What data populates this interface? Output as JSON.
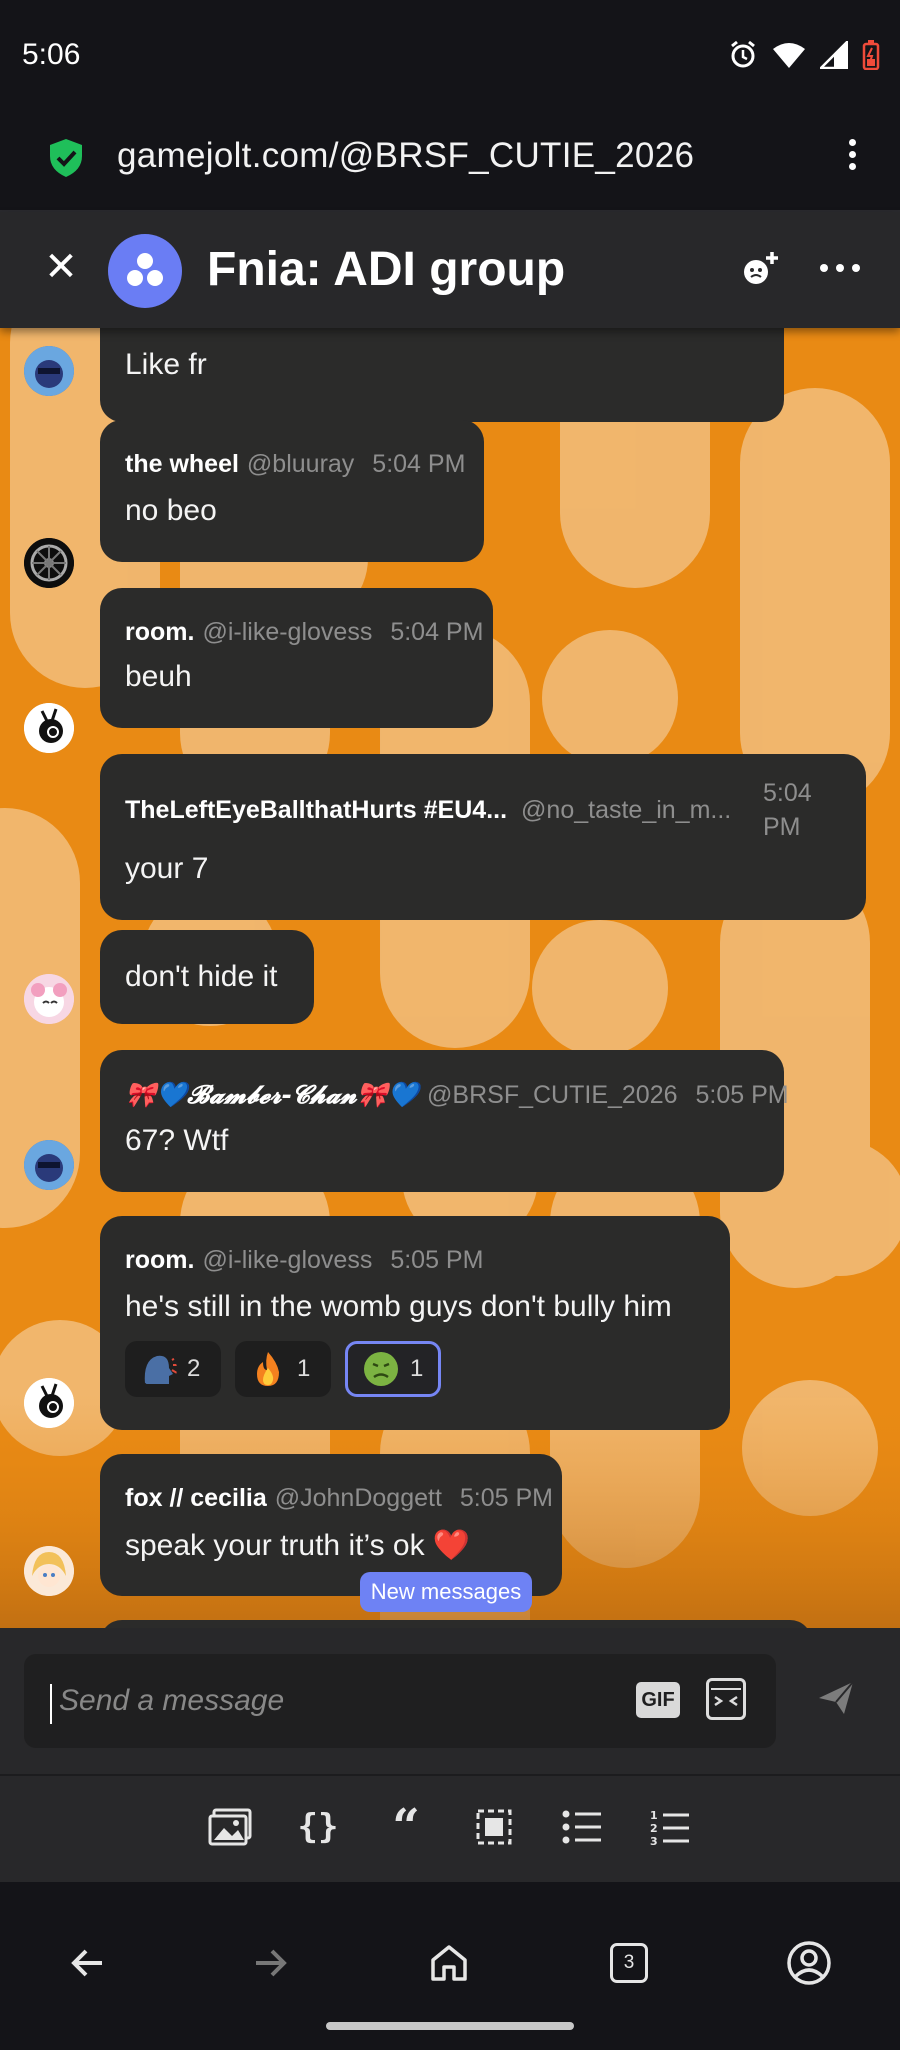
{
  "status_bar": {
    "time": "5:06"
  },
  "browser": {
    "url": "gamejolt.com/@BRSF_CUTIE_2026"
  },
  "chat": {
    "title": "Fnia: ADI group"
  },
  "messages": [
    {
      "body": "Like fr"
    },
    {
      "name": "the wheel",
      "user": "@bluuray",
      "time": "5:04 PM",
      "body": "no beo"
    },
    {
      "name": "room.",
      "user": "@i-like-glovess",
      "time": "5:04 PM",
      "body": "beuh"
    },
    {
      "name": "TheLeftEyeBallthatHurts #EU4...",
      "user": "@no_taste_in_m...",
      "time": "5:04 PM",
      "body": "your 7"
    },
    {
      "body": "don't hide it"
    },
    {
      "name": "🎀💙𝓑𝓪𝓶𝓫𝓮𝓻-𝓒𝓱𝓪𝓷🎀💙",
      "user": "@BRSF_CUTIE_2026",
      "time": "5:05 PM",
      "body": "67? Wtf"
    },
    {
      "name": "room.",
      "user": "@i-like-glovess",
      "time": "5:05 PM",
      "body": "he's still in the womb guys don't bully him",
      "reactions": [
        {
          "emoji": "speaking-head-icon",
          "count": "2"
        },
        {
          "emoji": "fire-icon",
          "count": "1"
        },
        {
          "emoji": "nauseated-face-icon",
          "count": "1"
        }
      ]
    },
    {
      "name": "fox // cecilia",
      "user": "@JohnDoggett",
      "time": "5:05 PM",
      "body": "speak your truth it’s ok ❤️"
    }
  ],
  "new_messages_label": "New messages",
  "composer": {
    "placeholder": "Send a message",
    "gif_label": "GIF"
  },
  "nav": {
    "tab_count": "3"
  },
  "colors": {
    "accent": "#6e82f4",
    "chat_bg": "#e98a14",
    "bubble": "#2b2b2a"
  }
}
